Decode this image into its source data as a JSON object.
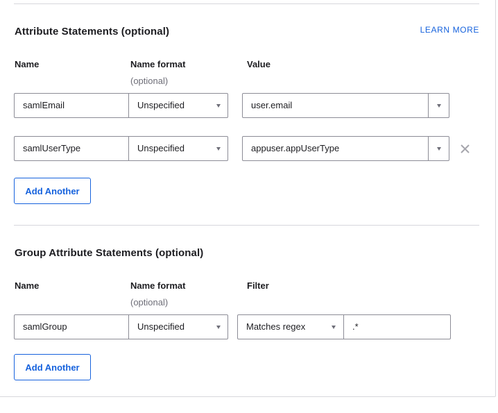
{
  "attribute_statements": {
    "title": "Attribute Statements (optional)",
    "learn_more": "LEARN MORE",
    "columns": {
      "name": "Name",
      "name_format": "Name format",
      "name_format_sub": "(optional)",
      "value": "Value"
    },
    "rows": [
      {
        "name": "samlEmail",
        "format": "Unspecified",
        "value": "user.email",
        "removable": false
      },
      {
        "name": "samlUserType",
        "format": "Unspecified",
        "value": "appuser.appUserType",
        "removable": true
      }
    ],
    "add_button": "Add Another"
  },
  "group_attribute_statements": {
    "title": "Group Attribute Statements (optional)",
    "columns": {
      "name": "Name",
      "name_format": "Name format",
      "name_format_sub": "(optional)",
      "filter": "Filter"
    },
    "rows": [
      {
        "name": "samlGroup",
        "format": "Unspecified",
        "filter_type": "Matches regex",
        "filter_value": ".*"
      }
    ],
    "add_button": "Add Another"
  },
  "icons": {
    "remove": "close-icon",
    "dropdown": "chevron-down-icon"
  },
  "colors": {
    "accent": "#1662dd",
    "border": "#8c8c96",
    "divider": "#d7d7dc",
    "muted": "#6e6e78"
  }
}
